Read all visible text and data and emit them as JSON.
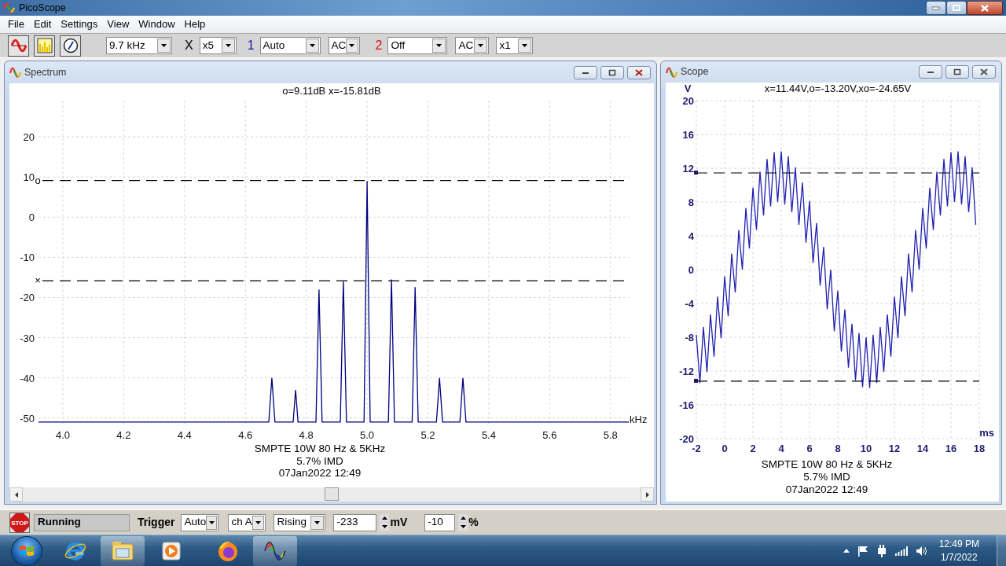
{
  "window": {
    "title": "PicoScope"
  },
  "menu": [
    {
      "label": "File"
    },
    {
      "label": "Edit"
    },
    {
      "label": "Settings"
    },
    {
      "label": "View"
    },
    {
      "label": "Window"
    },
    {
      "label": "Help"
    }
  ],
  "toolbar": [
    {
      "kind": "combo",
      "value": "9.7 kHz"
    },
    {
      "kind": "label",
      "text": "X",
      "color": "#000000"
    },
    {
      "kind": "combo",
      "value": "x5"
    },
    {
      "kind": "label",
      "text": "1",
      "color": "#1a1aa0"
    },
    {
      "kind": "combo",
      "value": "Auto"
    },
    {
      "kind": "combo",
      "value": "AC"
    },
    {
      "kind": "label",
      "text": "2",
      "color": "#e01010"
    },
    {
      "kind": "combo",
      "value": "Off"
    },
    {
      "kind": "combo",
      "value": "AC"
    },
    {
      "kind": "combo",
      "value": "x1"
    }
  ],
  "windows": [
    {
      "title": "Spectrum",
      "readout": "o=9.11dB  x=-15.81dB",
      "captions": [
        "SMPTE 10W 80 Hz & 5KHz",
        "5.7% IMD",
        "07Jan2022  12:49"
      ],
      "chart_data": {
        "type": "line",
        "xlabel": "kHz",
        "x": [
          3.92,
          4.677,
          4.687,
          4.697,
          4.757,
          4.765,
          4.773,
          4.832,
          4.842,
          4.852,
          4.912,
          4.922,
          4.932,
          4.99,
          5.0,
          5.01,
          5.07,
          5.08,
          5.09,
          5.148,
          5.158,
          5.168,
          5.228,
          5.238,
          5.248,
          5.305,
          5.315,
          5.325,
          5.86
        ],
        "series": [
          {
            "color": "#000080",
            "values": [
              -51,
              -51,
              -40,
              -51,
              -51,
              -43,
              -51,
              -51,
              -18,
              -51,
              -51,
              -16,
              -51,
              -51,
              9,
              -51,
              -51,
              -15.5,
              -51,
              -51,
              -17.4,
              -51,
              -51,
              -40,
              -51,
              -51,
              -40,
              -51,
              -51
            ]
          }
        ],
        "xlim": [
          3.92,
          5.86
        ],
        "ylim": [
          -52,
          29
        ],
        "xticks": [
          {
            "value": 4,
            "label": "4.0"
          },
          4.2,
          4.4,
          4.6,
          4.8,
          {
            "value": 5,
            "label": "5.0"
          },
          5.2,
          5.4,
          5.6,
          5.8
        ],
        "yticks": [
          20,
          10,
          0,
          -10,
          -20,
          -30,
          -40,
          -50
        ],
        "grid": true,
        "ref_lines": [
          {
            "axis": "y",
            "value": 9.11,
            "label": "o"
          },
          {
            "axis": "y",
            "value": -15.81,
            "label": "×"
          }
        ]
      }
    },
    {
      "title": "Scope",
      "readout": "x=11.44V,o=-13.20V,xo=-24.65V",
      "captions": [
        "SMPTE 10W 80 Hz & 5KHz",
        "5.7% IMD",
        "07Jan2022  12:49"
      ],
      "chart_data": {
        "type": "line",
        "xlabel": "ms",
        "ylabel": "V",
        "x": [
          -2,
          -1.75,
          -1.5,
          -1.25,
          -1,
          -0.75,
          -0.5,
          -0.25,
          0,
          0.25,
          0.5,
          0.75,
          1,
          1.25,
          1.5,
          1.75,
          2,
          2.25,
          2.5,
          2.75,
          3,
          3.25,
          3.5,
          3.75,
          4,
          4.25,
          4.5,
          4.75,
          5,
          5.25,
          5.5,
          5.75,
          6,
          6.25,
          6.5,
          6.75,
          7,
          7.25,
          7.5,
          7.75,
          8,
          8.25,
          8.5,
          8.75,
          9,
          9.25,
          9.5,
          9.75,
          10,
          10.25,
          10.5,
          10.75,
          11,
          11.25,
          11.5,
          11.75,
          12,
          12.25,
          12.5,
          12.75,
          13,
          13.25,
          13.5,
          13.75,
          14,
          14.25,
          14.5,
          14.75,
          15,
          15.25,
          15.5,
          15.75,
          16,
          16.25,
          16.5,
          16.75,
          17,
          17.25,
          17.5,
          17.75
        ],
        "series": [
          {
            "color": "#2020b0",
            "values": [
              -7.7,
              -13.4,
              -6.8,
              -12.1,
              -5.3,
              -10.3,
              -3.2,
              -8.1,
              -0.8,
              -5.5,
              1.9,
              -2.7,
              4.7,
              0.0,
              7.3,
              2.5,
              9.7,
              4.7,
              11.6,
              6.4,
              13.1,
              7.5,
              13.9,
              8.0,
              14.0,
              7.7,
              13.4,
              6.8,
              12.1,
              5.3,
              10.3,
              3.2,
              8.1,
              0.8,
              5.5,
              -1.9,
              2.7,
              -4.7,
              0.0,
              -7.3,
              -2.5,
              -9.7,
              -4.7,
              -11.6,
              -6.4,
              -13.1,
              -7.5,
              -13.9,
              -8.0,
              -14.0,
              -7.7,
              -13.4,
              -6.8,
              -12.1,
              -5.3,
              -10.3,
              -3.2,
              -8.1,
              -0.8,
              -5.5,
              1.9,
              -2.7,
              4.7,
              0.0,
              7.3,
              2.5,
              9.7,
              4.7,
              11.6,
              6.4,
              13.1,
              7.5,
              13.9,
              8.0,
              14.0,
              7.7,
              13.4,
              6.8,
              12.1,
              5.3
            ]
          }
        ],
        "xlim": [
          -2,
          18
        ],
        "ylim": [
          -20,
          20
        ],
        "xticks": [
          -2,
          0,
          2,
          4,
          6,
          8,
          10,
          12,
          14,
          16,
          18
        ],
        "yticks": [
          20,
          16,
          12,
          8,
          4,
          0,
          -4,
          -8,
          -12,
          -16,
          -20
        ],
        "grid": true,
        "ref_lines": [
          {
            "axis": "y",
            "value": 11.44
          },
          {
            "axis": "y",
            "value": -13.2
          }
        ]
      }
    }
  ],
  "status_bar": {
    "stop": "STOP",
    "state": "Running",
    "trigger_label": "Trigger",
    "trigger_mode": "Auto",
    "trigger_channel": "ch A",
    "trigger_edge": "Rising",
    "trigger_level": "-233",
    "level_unit": "mV",
    "pre_trigger": "-10",
    "pre_unit": "%"
  },
  "taskbar": {
    "apps": [
      {
        "kind": "browser",
        "running": false
      },
      {
        "kind": "folder",
        "running": true
      },
      {
        "kind": "media",
        "running": false
      },
      {
        "kind": "firefox",
        "running": false
      },
      {
        "kind": "scope",
        "running": true
      }
    ],
    "clock": {
      "time": "12:49 PM",
      "date": "1/7/2022"
    }
  }
}
